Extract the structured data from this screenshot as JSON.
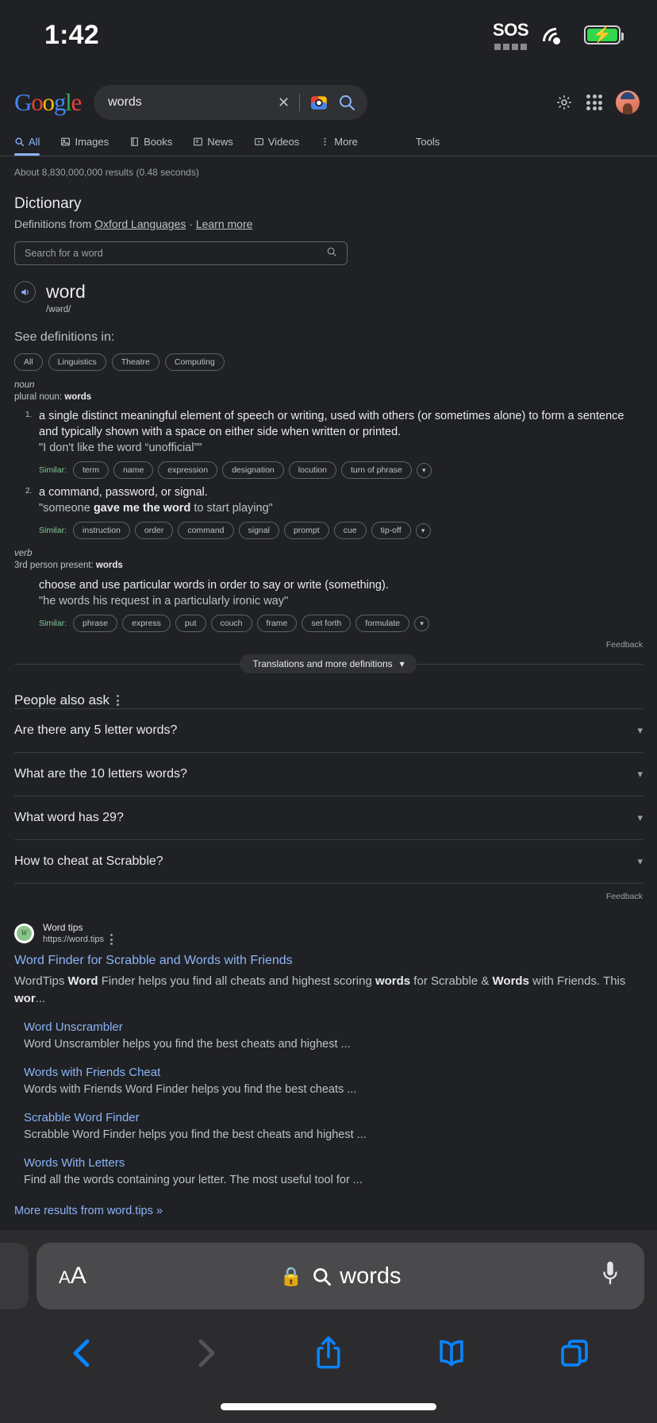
{
  "status_bar": {
    "time": "1:42",
    "sos_label": "SOS",
    "wifi_icon": "wifi-icon",
    "battery_icon": "battery-charging-icon"
  },
  "google_header": {
    "logo_letters": [
      "G",
      "o",
      "o",
      "g",
      "l",
      "e"
    ],
    "search_value": "words",
    "clear_icon": "close-icon",
    "lens_icon": "google-lens-icon",
    "search_icon": "search-icon",
    "settings_icon": "gear-icon",
    "apps_icon": "apps-grid-icon",
    "avatar_icon": "account-avatar"
  },
  "tabs": [
    {
      "label": "All",
      "icon": "search-icon",
      "active": true
    },
    {
      "label": "Images",
      "icon": "image-icon",
      "active": false
    },
    {
      "label": "Books",
      "icon": "book-icon",
      "active": false
    },
    {
      "label": "News",
      "icon": "news-icon",
      "active": false
    },
    {
      "label": "Videos",
      "icon": "video-icon",
      "active": false
    },
    {
      "label": "More",
      "icon": "kebab-icon",
      "active": false
    }
  ],
  "tools_label": "Tools",
  "results_count": "About 8,830,000,000 results (0.48 seconds)",
  "dictionary": {
    "title": "Dictionary",
    "source_prefix": "Definitions from ",
    "source_link": "Oxford Languages",
    "source_sep": " · ",
    "learn_more": "Learn more",
    "word_search_placeholder": "Search for a word",
    "word_search_icon": "search-icon",
    "headword": "word",
    "speaker_icon": "speaker-icon",
    "phonetic": "/wərd/",
    "see_definitions_label": "See definitions in:",
    "domain_chips": [
      "All",
      "Linguistics",
      "Theatre",
      "Computing"
    ],
    "entries": [
      {
        "pos": "noun",
        "inflection_label": "plural noun: ",
        "inflection_value": "words",
        "senses": [
          {
            "number": "1.",
            "definition": "a single distinct meaningful element of speech or writing, used with others (or sometimes alone) to form a sentence and typically shown with a space on either side when written or printed.",
            "example_pre": "\"I don't like the word “unofficial”\"",
            "example_bold": "",
            "example_post": "",
            "similar_label": "Similar:",
            "similar": [
              "term",
              "name",
              "expression",
              "designation",
              "locution",
              "turn of phrase"
            ]
          },
          {
            "number": "2.",
            "definition": "a command, password, or signal.",
            "example_pre": "\"someone ",
            "example_bold": "gave me the word",
            "example_post": " to start playing\"",
            "similar_label": "Similar:",
            "similar": [
              "instruction",
              "order",
              "command",
              "signal",
              "prompt",
              "cue",
              "tip-off"
            ]
          }
        ]
      },
      {
        "pos": "verb",
        "inflection_label": "3rd person present: ",
        "inflection_value": "words",
        "senses": [
          {
            "number": "",
            "definition": "choose and use particular words in order to say or write (something).",
            "example_pre": "\"he words his request in a particularly ironic way\"",
            "example_bold": "",
            "example_post": "",
            "similar_label": "Similar:",
            "similar": [
              "phrase",
              "express",
              "put",
              "couch",
              "frame",
              "set forth",
              "formulate"
            ]
          }
        ]
      }
    ],
    "feedback_label": "Feedback",
    "translations_button": "Translations and more definitions",
    "translations_chevron": "chevron-down-icon"
  },
  "people_also_ask": {
    "title": "People also ask",
    "menu_icon": "kebab-icon",
    "questions": [
      "Are there any 5 letter words?",
      "What are the 10 letters words?",
      "What word has 29?",
      "How to cheat at Scrabble?"
    ],
    "expand_icon": "chevron-down-icon",
    "feedback_label": "Feedback"
  },
  "search_result": {
    "favicon_letter": "W",
    "site_name": "Word tips",
    "site_url": "https://word.tips",
    "overflow_icon": "kebab-icon",
    "title": "Word Finder for Scrabble and Words with Friends",
    "snippet_parts": [
      {
        "text": "WordTips ",
        "bold": false
      },
      {
        "text": "Word",
        "bold": true
      },
      {
        "text": " Finder helps you find all cheats and highest scoring ",
        "bold": false
      },
      {
        "text": "words",
        "bold": true
      },
      {
        "text": " for Scrabble & ",
        "bold": false
      },
      {
        "text": "Words",
        "bold": true
      },
      {
        "text": " with Friends. This ",
        "bold": false
      },
      {
        "text": "wor",
        "bold": true
      },
      {
        "text": "...",
        "bold": false
      }
    ],
    "sitelinks": [
      {
        "title": "Word Unscrambler",
        "snippet": "Word Unscrambler helps you find the best cheats and highest ..."
      },
      {
        "title": "Words with Friends Cheat",
        "snippet": "Words with Friends Word Finder helps you find the best cheats ..."
      },
      {
        "title": "Scrabble Word Finder",
        "snippet": "Scrabble Word Finder helps you find the best cheats and highest ..."
      },
      {
        "title": "Words With Letters",
        "snippet": "Find all the words containing your letter. The most useful tool for ..."
      }
    ],
    "more_results": "More results from word.tips »"
  },
  "safari_toolbar": {
    "text_size_small": "A",
    "text_size_large": "A",
    "lock_icon": "lock-icon",
    "search_icon": "search-icon",
    "url_text": "words",
    "mic_icon": "microphone-icon",
    "back_icon": "back-chevron-icon",
    "forward_icon": "forward-chevron-icon",
    "share_icon": "share-icon",
    "bookmarks_icon": "book-icon",
    "tabs_icon": "tabs-icon"
  },
  "colors": {
    "background": "#202124",
    "link": "#8ab4f8",
    "similar": "#81c995",
    "accent_blue": "#0a84ff",
    "battery_green": "#32d74b"
  }
}
